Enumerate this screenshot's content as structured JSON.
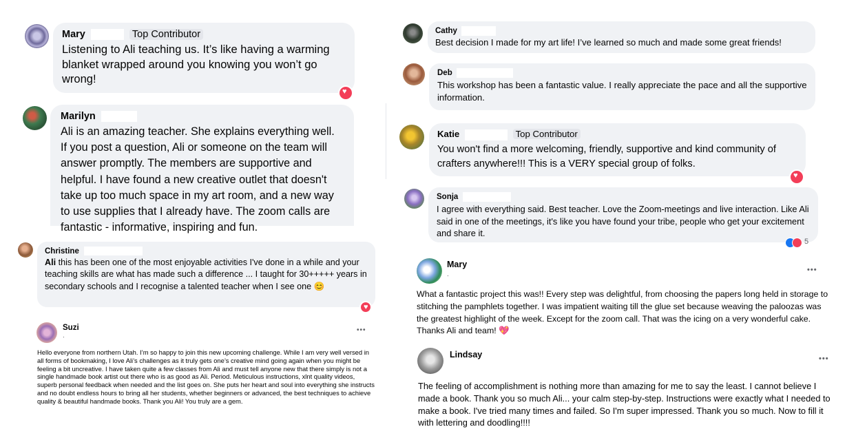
{
  "colors": {
    "bubble": "#f0f2f5",
    "heart": "#f33e58",
    "like": "#1877f2",
    "meta": "#65676b"
  },
  "comments": {
    "mary": {
      "name": "Mary",
      "badge": "Top Contributor",
      "text": "Listening to Ali teaching us. It’s like having a warming blanket wrapped around you knowing you won’t go wrong!",
      "reaction": "heart"
    },
    "marilyn": {
      "name": "Marilyn",
      "text": "Ali is an amazing teacher. She explains everything well. If you post a question, Ali or someone on the team will answer promptly. The members are supportive and helpful. I have found a new creative outlet that doesn't take up too much space in my art room, and a new way to use supplies that I already have. The zoom calls are fantastic - informative, inspiring and fun."
    },
    "christine": {
      "name": "Christine",
      "mention": "Ali",
      "text": " this has been one of the most enjoyable activities I've done in a while and your teaching skills are what has made such a difference ... I taught for 30+++++ years in secondary schools and I recognise a talented teacher when I see one 😊",
      "reaction": "heart"
    },
    "cathy": {
      "name": "Cathy",
      "text": "Best decision I made for my art life! I’ve learned so much and made some great friends!"
    },
    "deb": {
      "name": "Deb",
      "text": "This workshop has been a fantastic value. I really appreciate the pace and all the supportive information."
    },
    "katie": {
      "name": "Katie",
      "badge": "Top Contributor",
      "text": "You won't find a more welcoming, friendly, supportive and kind community of crafters anywhere!!! This is a VERY special group of folks.",
      "reaction": "heart"
    },
    "sonja": {
      "name": "Sonja",
      "text": "I agree with everything said. Best teacher. Love the Zoom-meetings and live interaction. Like Ali said in one of the meetings, it's like you have found your tribe, people who get your excitement and share it.",
      "reaction_count": "5"
    }
  },
  "posts": {
    "suzi": {
      "name": "Suzi",
      "meta": ".",
      "more": "•••",
      "text": "Hello everyone from northern Utah.  I’m so happy to join this new upcoming challenge.   While I am very well versed in all forms of bookmaking, I love Ali’s challenges as it truly gets one’s creative mind going again when you might be feeling a bit uncreative.  I have taken quite a few classes from Ali and must tell anyone new that there simply is not a single handmade book artist out there who is as good as Ali. Period.   Meticulous instructions, xlnt quality videos, superb personal feedback when needed and the list goes on.  She puts her heart and soul into everything she instructs and no doubt endless hours to bring all her students, whether beginners or advanced, the best techniques to achieve quality & beautiful handmade books.  Thank you Ali!  You truly are a gem."
    },
    "mary2": {
      "name": "Mary",
      "meta": ".",
      "more": "•••",
      "text": "What a fantastic project this was!! Every step was delightful, from choosing the papers long held in storage to stitching the pamphlets together. I was impatient waiting till the glue set because weaving the paloozas was the greatest highlight of the week. Except for the zoom call. That was the icing on a very wonderful cake. Thanks Ali and team! 💖"
    },
    "lindsay": {
      "name": "Lindsay",
      "more": "•••",
      "text": "The feeling of accomplishment is nothing more than amazing for me to say the least. I cannot believe I made a book. Thank you so much Ali... your calm step-by-step. Instructions were exactly what I needed to make a book. I've tried many times and failed. So I'm super impressed. Thank you so much. Now to fill it with lettering and doodling!!!!"
    }
  }
}
